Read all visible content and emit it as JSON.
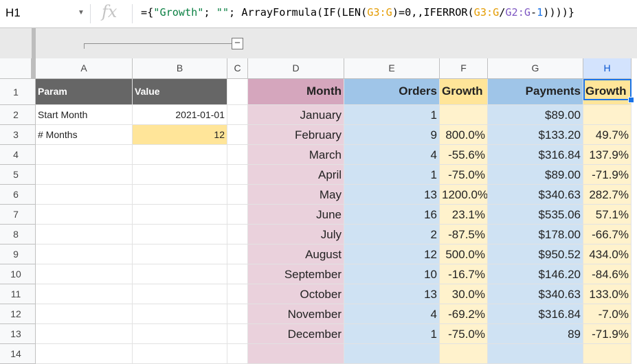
{
  "formula_bar": {
    "name_box": "H1",
    "fx_label": "fx",
    "formula_parts": [
      {
        "t": "={",
        "k": "plain"
      },
      {
        "t": "\"Growth\"",
        "k": "str"
      },
      {
        "t": "; ",
        "k": "plain"
      },
      {
        "t": "\"\"",
        "k": "str"
      },
      {
        "t": "; ArrayFormula(IF(LEN(",
        "k": "plain"
      },
      {
        "t": "G3:G",
        "k": "ref1"
      },
      {
        "t": ")=0,,IFERROR(",
        "k": "plain"
      },
      {
        "t": "G3:G",
        "k": "ref1"
      },
      {
        "t": "/",
        "k": "plain"
      },
      {
        "t": "G2:G",
        "k": "ref2"
      },
      {
        "t": "-",
        "k": "plain"
      },
      {
        "t": "1",
        "k": "num"
      },
      {
        "t": "))))}",
        "k": "plain"
      }
    ]
  },
  "columns": [
    "A",
    "B",
    "C",
    "D",
    "E",
    "F",
    "G",
    "H"
  ],
  "selected_column": "H",
  "rows": [
    "1",
    "2",
    "3",
    "4",
    "5",
    "6",
    "7",
    "8",
    "9",
    "10",
    "11",
    "12",
    "13",
    "14"
  ],
  "params": {
    "header": [
      "Param",
      "Value"
    ],
    "rows": [
      [
        "Start Month",
        "2021-01-01"
      ],
      [
        "# Months",
        "12"
      ]
    ]
  },
  "table": {
    "headers": [
      "Month",
      "Orders",
      "Growth",
      "Payments",
      "Growth"
    ],
    "rows": [
      [
        "January",
        "1",
        "",
        "$89.00",
        ""
      ],
      [
        "February",
        "9",
        "800.0%",
        "$133.20",
        "49.7%"
      ],
      [
        "March",
        "4",
        "-55.6%",
        "$316.84",
        "137.9%"
      ],
      [
        "April",
        "1",
        "-75.0%",
        "$89.00",
        "-71.9%"
      ],
      [
        "May",
        "13",
        "1200.0%",
        "$340.63",
        "282.7%"
      ],
      [
        "June",
        "16",
        "23.1%",
        "$535.06",
        "57.1%"
      ],
      [
        "July",
        "2",
        "-87.5%",
        "$178.00",
        "-66.7%"
      ],
      [
        "August",
        "12",
        "500.0%",
        "$950.52",
        "434.0%"
      ],
      [
        "September",
        "10",
        "-16.7%",
        "$146.20",
        "-84.6%"
      ],
      [
        "October",
        "13",
        "30.0%",
        "$340.63",
        "133.0%"
      ],
      [
        "November",
        "4",
        "-69.2%",
        "$316.84",
        "-7.0%"
      ],
      [
        "December",
        "1",
        "-75.0%",
        "89",
        "-71.9%"
      ]
    ]
  },
  "colors": {
    "param_header": "#666666",
    "input_cell": "#ffe599",
    "month_header": "#d5a6bd",
    "month_fill": "#ead1dc",
    "data_header": "#9fc5e8",
    "data_fill": "#cfe2f3",
    "growth_header": "#ffe599",
    "growth_fill": "#fff2cc",
    "selection": "#1a73e8"
  },
  "icons": [
    "dropdown-caret-icon",
    "fx-icon",
    "collapse-minus-icon"
  ],
  "collapse_symbol": "−"
}
